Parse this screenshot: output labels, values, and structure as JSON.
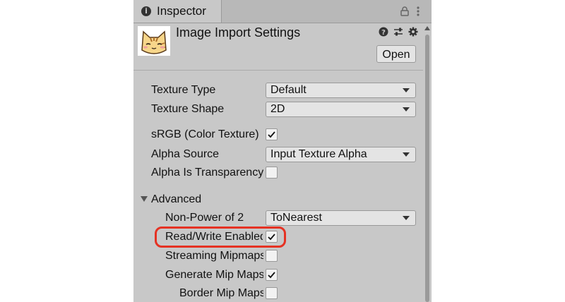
{
  "tab": {
    "label": "Inspector",
    "icon": "info-icon"
  },
  "header": {
    "title": "Image Import Settings",
    "open_label": "Open",
    "icons": [
      "cat-thumbnail-icon",
      "help-icon",
      "preset-icon",
      "gear-icon"
    ]
  },
  "fields": {
    "texture_type": {
      "label": "Texture Type",
      "value": "Default"
    },
    "texture_shape": {
      "label": "Texture Shape",
      "value": "2D"
    },
    "srgb": {
      "label": "sRGB (Color Texture)",
      "checked": true
    },
    "alpha_source": {
      "label": "Alpha Source",
      "value": "Input Texture Alpha"
    },
    "alpha_transparency": {
      "label": "Alpha Is Transparency",
      "checked": false
    }
  },
  "advanced": {
    "label": "Advanced",
    "expanded": true,
    "non_power_of_2": {
      "label": "Non-Power of 2",
      "value": "ToNearest"
    },
    "read_write": {
      "label": "Read/Write Enabled",
      "checked": true
    },
    "streaming_mipmaps": {
      "label": "Streaming Mipmaps",
      "checked": false
    },
    "generate_mip_maps": {
      "label": "Generate Mip Maps",
      "checked": true
    },
    "border_mip_maps": {
      "label": "Border Mip Maps",
      "checked": false
    }
  },
  "colors": {
    "panel": "#c8c8c8",
    "highlight": "#e53223"
  }
}
